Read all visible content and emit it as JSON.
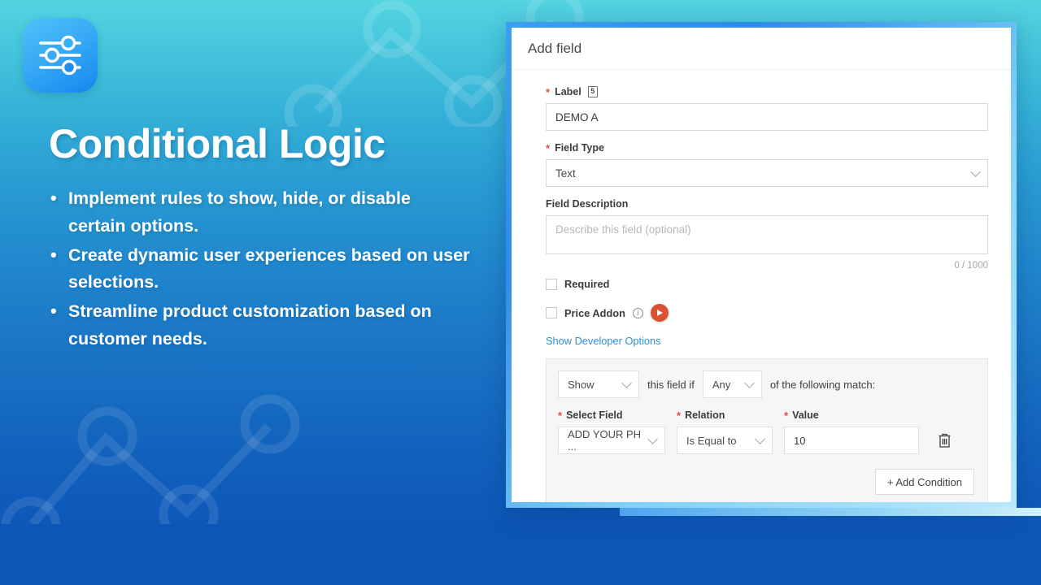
{
  "brand": {
    "logo_icon": "sliders-icon",
    "accent_blue": "#1587f0",
    "gradient_top": "#54d4e0",
    "gradient_bottom": "#0b51b4"
  },
  "hero": {
    "headline": "Conditional Logic",
    "bullets": [
      "Implement rules to show, hide, or disable certain options.",
      "Create dynamic user experiences based on user selections.",
      "Streamline product customization based on customer needs."
    ]
  },
  "modal": {
    "title": "Add field",
    "label_field": {
      "label": "Label",
      "required_marker": "*",
      "badge": "5",
      "value": "DEMO A"
    },
    "field_type": {
      "label": "Field Type",
      "required_marker": "*",
      "selected": "Text"
    },
    "field_description": {
      "label": "Field Description",
      "placeholder": "Describe this field (optional)",
      "value": "",
      "counter": "0 / 1000"
    },
    "required_checkbox": {
      "label": "Required",
      "checked": false
    },
    "price_addon_checkbox": {
      "label": "Price Addon",
      "checked": false,
      "info_icon": "info-icon",
      "play_icon": "play-icon",
      "play_color": "#dc4f32"
    },
    "developer_options_link": "Show Developer Options",
    "conditional_logic": {
      "action_select": "Show",
      "sentence_mid": "this field if",
      "match_select": "Any",
      "sentence_end": "of the following match:",
      "columns": {
        "select_field": "Select Field",
        "relation": "Relation",
        "value": "Value"
      },
      "required_marker": "*",
      "rows": [
        {
          "select_field": "ADD YOUR PH ...",
          "relation": "Is Equal to",
          "value": "10",
          "delete_icon": "trash-icon"
        }
      ],
      "add_condition_label": "+ Add Condition"
    }
  }
}
